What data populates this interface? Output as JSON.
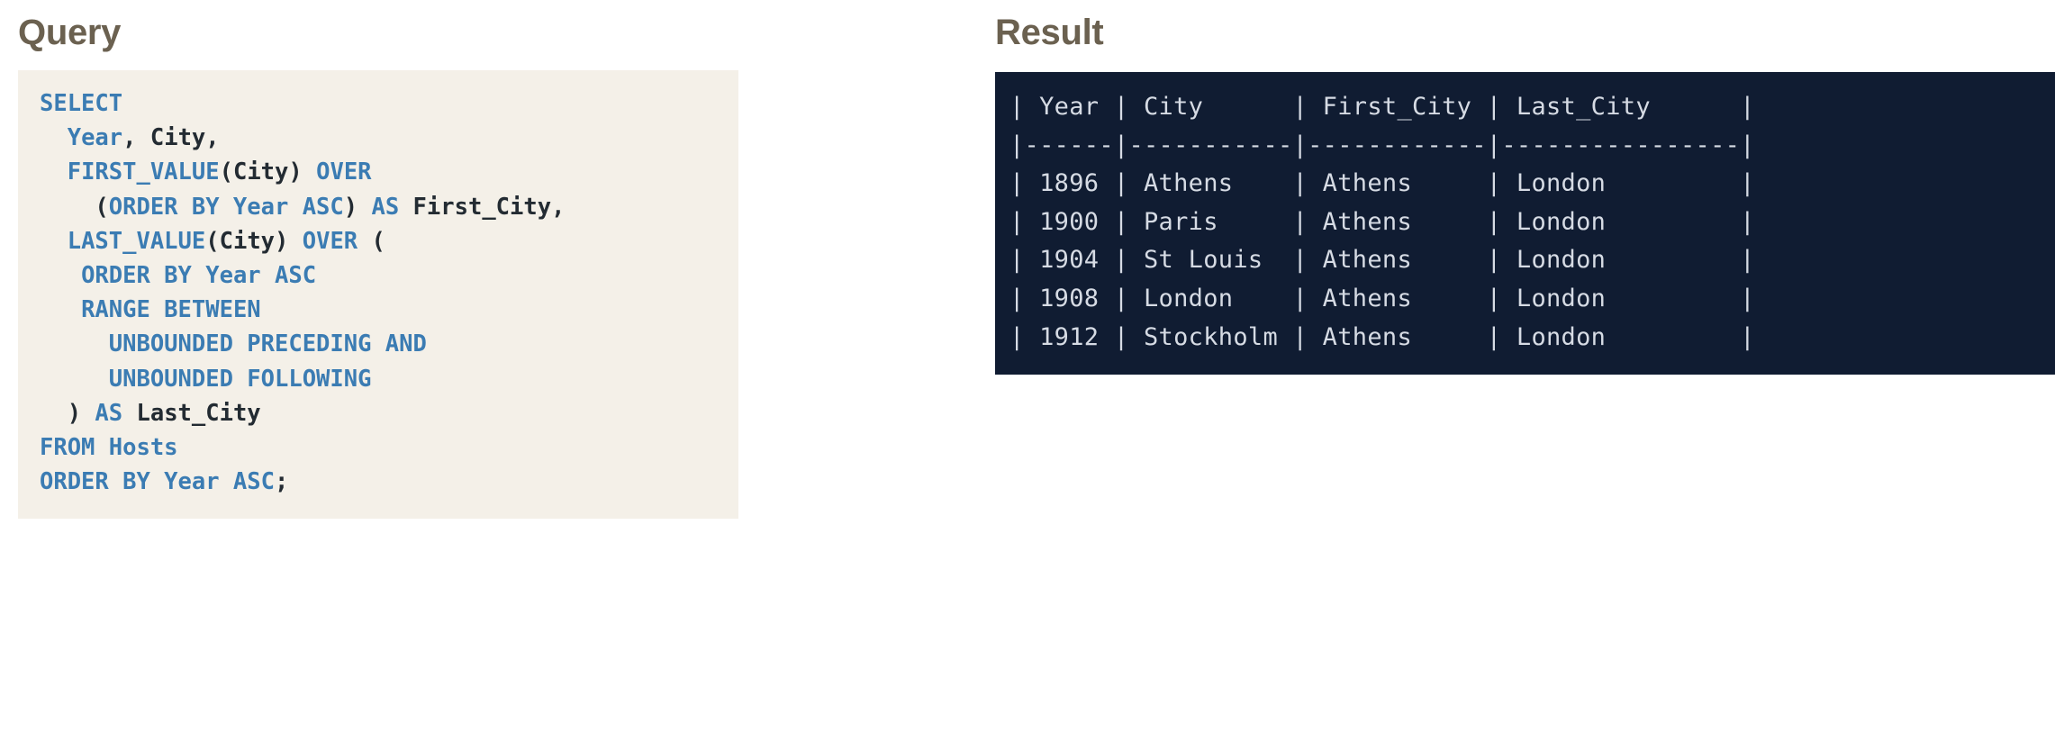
{
  "query_panel": {
    "heading": "Query",
    "language": "sql",
    "code_lines": [
      [
        {
          "t": "SELECT",
          "c": "kw"
        }
      ],
      [
        {
          "t": "  ",
          "c": "pn"
        },
        {
          "t": "Year",
          "c": "kw"
        },
        {
          "t": ", ",
          "c": "pn"
        },
        {
          "t": "City",
          "c": "id"
        },
        {
          "t": ",",
          "c": "pn"
        }
      ],
      [
        {
          "t": "  ",
          "c": "pn"
        },
        {
          "t": "FIRST_VALUE",
          "c": "kw"
        },
        {
          "t": "(",
          "c": "pn"
        },
        {
          "t": "City",
          "c": "id"
        },
        {
          "t": ") ",
          "c": "pn"
        },
        {
          "t": "OVER",
          "c": "kw"
        }
      ],
      [
        {
          "t": "    (",
          "c": "pn"
        },
        {
          "t": "ORDER BY Year ASC",
          "c": "kw"
        },
        {
          "t": ") ",
          "c": "pn"
        },
        {
          "t": "AS",
          "c": "kw"
        },
        {
          "t": " First_City,",
          "c": "id"
        }
      ],
      [
        {
          "t": "  ",
          "c": "pn"
        },
        {
          "t": "LAST_VALUE",
          "c": "kw"
        },
        {
          "t": "(",
          "c": "pn"
        },
        {
          "t": "City",
          "c": "id"
        },
        {
          "t": ") ",
          "c": "pn"
        },
        {
          "t": "OVER",
          "c": "kw"
        },
        {
          "t": " (",
          "c": "pn"
        }
      ],
      [
        {
          "t": "   ",
          "c": "pn"
        },
        {
          "t": "ORDER BY Year ASC",
          "c": "kw"
        }
      ],
      [
        {
          "t": "   ",
          "c": "pn"
        },
        {
          "t": "RANGE BETWEEN",
          "c": "kw"
        }
      ],
      [
        {
          "t": "     ",
          "c": "pn"
        },
        {
          "t": "UNBOUNDED PRECEDING AND",
          "c": "kw"
        }
      ],
      [
        {
          "t": "     ",
          "c": "pn"
        },
        {
          "t": "UNBOUNDED FOLLOWING",
          "c": "kw"
        }
      ],
      [
        {
          "t": "  ) ",
          "c": "pn"
        },
        {
          "t": "AS",
          "c": "kw"
        },
        {
          "t": " Last_City",
          "c": "id"
        }
      ],
      [
        {
          "t": "FROM",
          "c": "kw"
        },
        {
          "t": " Hosts",
          "c": "kw"
        }
      ],
      [
        {
          "t": "ORDER BY Year ASC",
          "c": "kw"
        },
        {
          "t": ";",
          "c": "id"
        }
      ]
    ],
    "code_plaintext": "SELECT\n  Year, City,\n  FIRST_VALUE(City) OVER\n    (ORDER BY Year ASC) AS First_City,\n  LAST_VALUE(City) OVER (\n   ORDER BY Year ASC\n   RANGE BETWEEN\n     UNBOUNDED PRECEDING AND\n     UNBOUNDED FOLLOWING\n  ) AS Last_City\nFROM Hosts\nORDER BY Year ASC;"
  },
  "result_panel": {
    "heading": "Result",
    "columns": [
      "Year",
      "City",
      "First_City",
      "Last_City"
    ],
    "rows": [
      [
        "1896",
        "Athens",
        "Athens",
        "London"
      ],
      [
        "1900",
        "Paris",
        "Athens",
        "London"
      ],
      [
        "1904",
        "St Louis",
        "Athens",
        "London"
      ],
      [
        "1908",
        "London",
        "Athens",
        "London"
      ],
      [
        "1912",
        "Stockholm",
        "Athens",
        "London"
      ]
    ],
    "ascii_lines": [
      "| Year | City      | First_City | Last_City      |",
      "|------|-----------|------------|----------------|",
      "| 1896 | Athens    | Athens     | London         |",
      "| 1900 | Paris     | Athens     | London         |",
      "| 1904 | St Louis  | Athens     | London         |",
      "| 1908 | London    | Athens     | London         |",
      "| 1912 | Stockholm | Athens     | London         |"
    ],
    "ascii_text": "| Year | City      | First_City | Last_City      |\n|------|-----------|------------|----------------|\n| 1896 | Athens    | Athens     | London         |\n| 1900 | Paris     | Athens     | London         |\n| 1904 | St Louis  | Athens     | London         |\n| 1908 | London    | Athens     | London         |\n| 1912 | Stockholm | Athens     | London         |"
  },
  "colors": {
    "page_background": "#ffffff",
    "heading_text": "#6b6150",
    "code_background": "#f4f0e8",
    "code_keyword": "#3b7cb3",
    "code_identifier": "#232b32",
    "result_background": "#101c32",
    "result_text": "#d6dbe4"
  }
}
